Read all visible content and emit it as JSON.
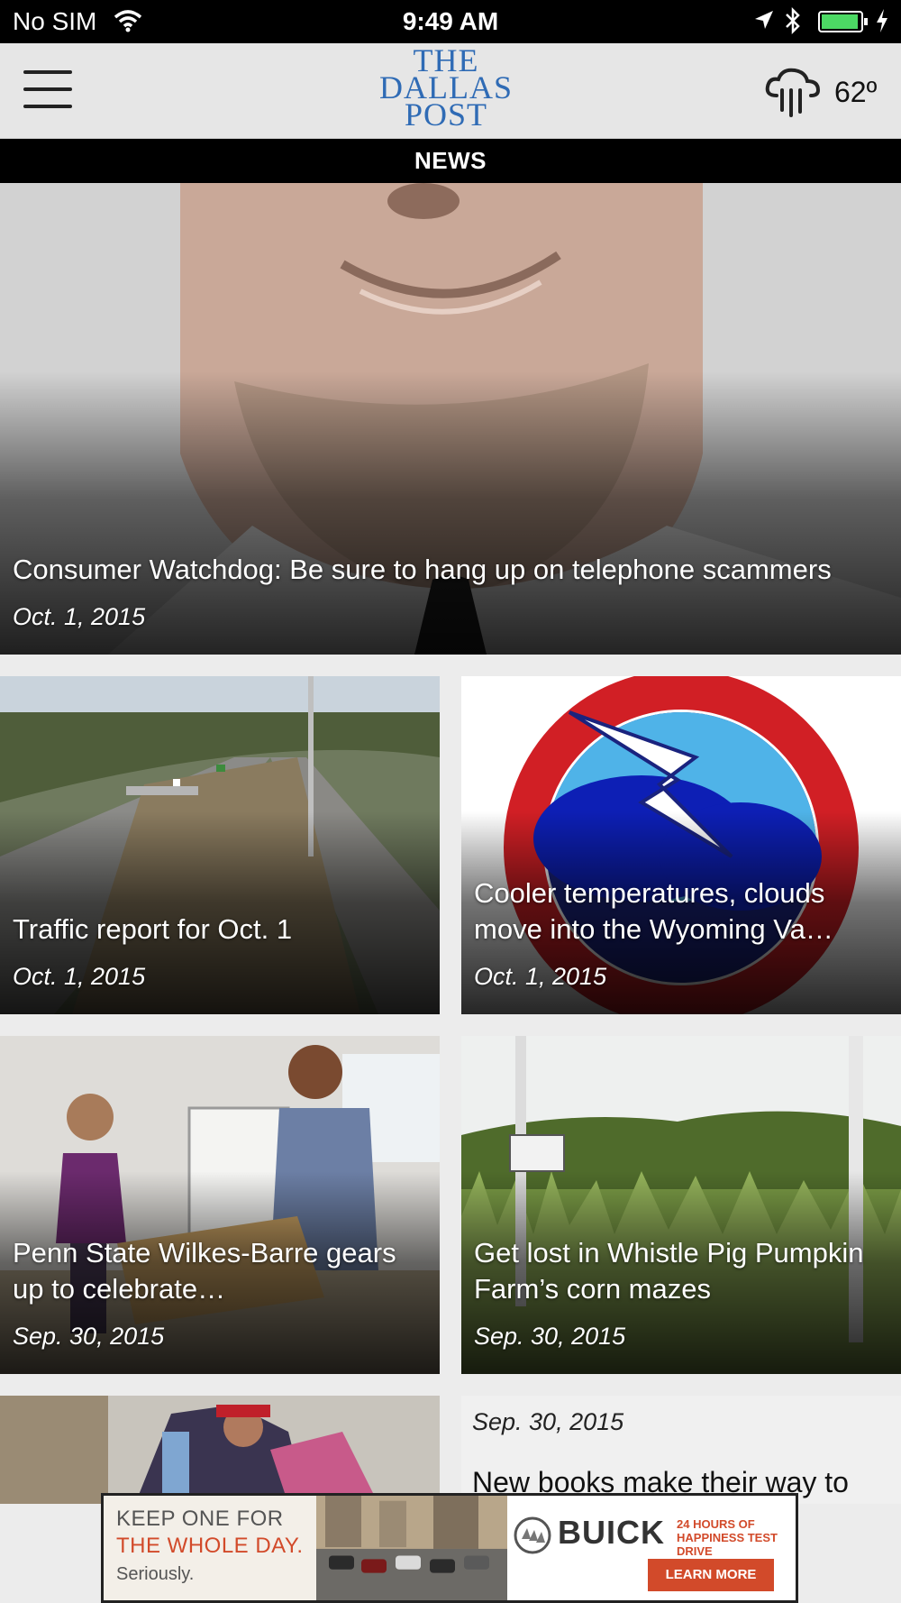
{
  "status_bar": {
    "carrier": "No SIM",
    "time": "9:49 AM"
  },
  "header": {
    "logo_line1": "THE",
    "logo_line2": "DALLAS",
    "logo_line3": "POST",
    "weather_icon": "rain-cloud-icon",
    "temperature": "62º"
  },
  "section": {
    "label": "NEWS"
  },
  "articles": [
    {
      "title": "Consumer Watchdog: Be sure to hang up on telephone scammers",
      "date": "Oct. 1, 2015"
    },
    {
      "title": "Traffic report for Oct. 1",
      "date": "Oct. 1, 2015"
    },
    {
      "title": "Cooler temperatures, clouds move into the Wyoming Va…",
      "date": "Oct. 1, 2015"
    },
    {
      "title": "Penn State Wilkes-Barre gears up to celebrate…",
      "date": "Sep. 30, 2015"
    },
    {
      "title": "Get lost in Whistle Pig Pumpkin Farm’s corn mazes",
      "date": "Sep. 30, 2015"
    },
    {
      "title": "New books make their way to",
      "date": "Sep. 30, 2015"
    }
  ],
  "ad": {
    "line1": "KEEP ONE FOR",
    "line2": "THE WHOLE DAY.",
    "line3": "Seriously.",
    "brand": "BUICK",
    "tagline_1": "24 HOURS OF",
    "tagline_2": "HAPPINESS TEST DRIVE",
    "cta": "LEARN MORE"
  },
  "colors": {
    "logo_blue": "#2f6bb5",
    "header_bg": "#e6e6e6",
    "ad_accent": "#d24a2a",
    "battery_green": "#4cd964"
  }
}
